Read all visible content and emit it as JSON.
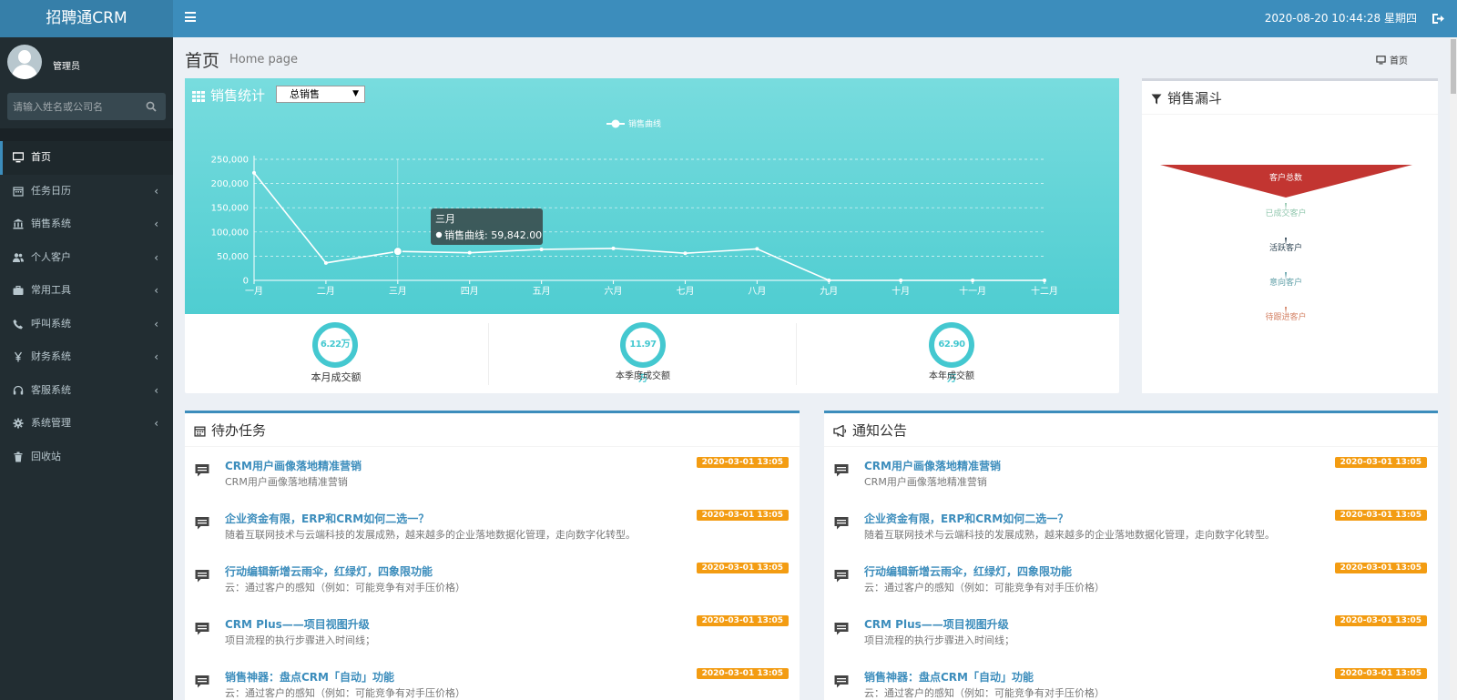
{
  "app": {
    "logo": "招聘通CRM",
    "datetime": "2020-08-20 10:44:28 星期四"
  },
  "user": {
    "name": "管理员"
  },
  "search": {
    "placeholder": "请输入姓名或公司名"
  },
  "menu": [
    {
      "label": "首页",
      "icon": "desktop-icon",
      "active": true,
      "submenu": false
    },
    {
      "label": "任务日历",
      "icon": "calendar-icon",
      "submenu": true
    },
    {
      "label": "销售系统",
      "icon": "bank-icon",
      "submenu": true
    },
    {
      "label": "个人客户",
      "icon": "users-icon",
      "submenu": true
    },
    {
      "label": "常用工具",
      "icon": "briefcase-icon",
      "submenu": true
    },
    {
      "label": "呼叫系统",
      "icon": "phone-icon",
      "submenu": true
    },
    {
      "label": "财务系统",
      "icon": "yen-icon",
      "submenu": true
    },
    {
      "label": "客服系统",
      "icon": "headset-icon",
      "submenu": true
    },
    {
      "label": "系统管理",
      "icon": "gear-icon",
      "submenu": true
    },
    {
      "label": "回收站",
      "icon": "trash-icon",
      "submenu": false
    }
  ],
  "header": {
    "title": "首页",
    "subtitle": "Home page",
    "breadcrumb": "首页"
  },
  "sales": {
    "title": "销售统计",
    "select_value": "总销售",
    "tooltip_title": "三月",
    "tooltip_value": "销售曲线: 59,842.00"
  },
  "chart_data": {
    "type": "line",
    "legend": "销售曲线",
    "legend_position": "top-center",
    "categories": [
      "一月",
      "二月",
      "三月",
      "四月",
      "五月",
      "六月",
      "七月",
      "八月",
      "九月",
      "十月",
      "十一月",
      "十二月"
    ],
    "series": [
      {
        "name": "销售曲线",
        "values": [
          222000,
          36000,
          59842,
          57000,
          64000,
          66000,
          56000,
          65000,
          0,
          0,
          0,
          0
        ]
      }
    ],
    "y_ticks": [
      "0",
      "50,000",
      "100,000",
      "150,000",
      "200,000",
      "250,000"
    ],
    "ylim": [
      0,
      250000
    ],
    "grid": true
  },
  "kpis": [
    {
      "value": "6.22万",
      "label": "本月成交额"
    },
    {
      "value": "11.97万",
      "label": "本季度成交额"
    },
    {
      "value": "62.90万",
      "label": "本年成交额"
    }
  ],
  "funnel": {
    "title": "销售漏斗",
    "stages": [
      {
        "label": "客户总数",
        "color": "#c23531"
      },
      {
        "label": "已成交客户",
        "color": "#91c7ae"
      },
      {
        "label": "活跃客户",
        "color": "#2f4554"
      },
      {
        "label": "意向客户",
        "color": "#61a0a8"
      },
      {
        "label": "待跟进客户",
        "color": "#d48265"
      }
    ]
  },
  "todo": {
    "title": "待办任务",
    "items": [
      {
        "title": "CRM用户画像落地精准营销",
        "desc": "CRM用户画像落地精准营销",
        "time": "2020-03-01 13:05"
      },
      {
        "title": "企业资金有限，ERP和CRM如何二选一？",
        "desc": "随着互联网技术与云端科技的发展成熟，越来越多的企业落地数据化管理，走向数字化转型。",
        "time": "2020-03-01 13:05"
      },
      {
        "title": "行动编辑新增云雨伞，红绿灯，四象限功能",
        "desc": "云：通过客户的感知（例如：可能竞争有对手压价格）",
        "time": "2020-03-01 13:05"
      },
      {
        "title": "CRM Plus——项目视图升级",
        "desc": "项目流程的执行步骤进入时间线；",
        "time": "2020-03-01 13:05"
      },
      {
        "title": "销售神器：盘点CRM「自动」功能",
        "desc": "云：通过客户的感知（例如：可能竞争有对手压价格）",
        "time": "2020-03-01 13:05"
      }
    ]
  },
  "notice": {
    "title": "通知公告",
    "items": [
      {
        "title": "CRM用户画像落地精准营销",
        "desc": "CRM用户画像落地精准营销",
        "time": "2020-03-01 13:05"
      },
      {
        "title": "企业资金有限，ERP和CRM如何二选一？",
        "desc": "随着互联网技术与云端科技的发展成熟，越来越多的企业落地数据化管理，走向数字化转型。",
        "time": "2020-03-01 13:05"
      },
      {
        "title": "行动编辑新增云雨伞，红绿灯，四象限功能",
        "desc": "云：通过客户的感知（例如：可能竞争有对手压价格）",
        "time": "2020-03-01 13:05"
      },
      {
        "title": "CRM Plus——项目视图升级",
        "desc": "项目流程的执行步骤进入时间线；",
        "time": "2020-03-01 13:05"
      },
      {
        "title": "销售神器：盘点CRM「自动」功能",
        "desc": "云：通过客户的感知（例如：可能竞争有对手压价格）",
        "time": "2020-03-01 13:05"
      }
    ]
  }
}
